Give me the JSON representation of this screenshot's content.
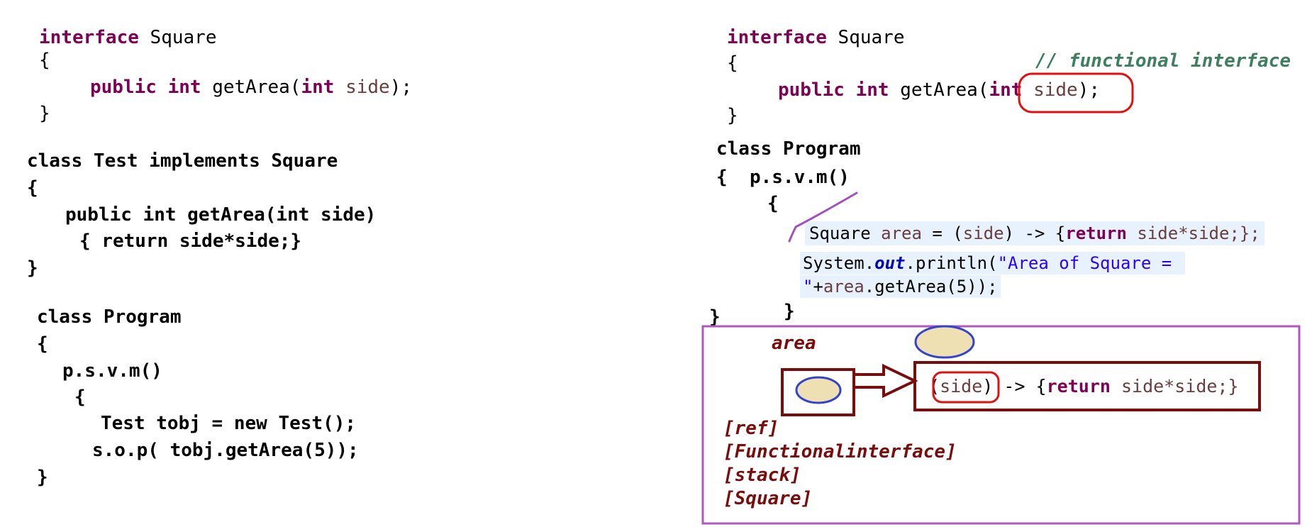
{
  "left": {
    "interface_kw": "interface",
    "interface_name": "Square",
    "open_brace": "{",
    "close_brace": "}",
    "method_public": "public",
    "method_int": "int",
    "method_name": "getArea(",
    "param_int": "int",
    "param_name": "side",
    "method_end": ");",
    "class_test_line": "class Test implements Square",
    "test_open": "{",
    "test_method": "public int getArea(int side)",
    "test_body": "{ return side*side;}",
    "test_close": "}",
    "program_line": "class Program",
    "program_open": "{",
    "psvm": "p.s.v.m()",
    "main_open": "{",
    "tobj_line": "Test tobj = new Test();",
    "sop_line": "s.o.p( tobj.getArea(5));",
    "main_close": "}"
  },
  "right": {
    "interface_kw": "interface",
    "interface_name": "Square",
    "open_brace": "{",
    "comment": "// functional interface",
    "method_public": "public",
    "method_int": "int",
    "method_name": "getArea(",
    "param_int": "int",
    "param_name": "side",
    "method_end": ");",
    "close_brace": "}",
    "program_line": "class Program",
    "program_open": "{",
    "psvm": "p.s.v.m()",
    "main_open": "{",
    "lambda_type": "Square",
    "lambda_var": "area",
    "lambda_eq": " = (",
    "lambda_param": "side",
    "lambda_arrow": ") -> {",
    "lambda_return": "return",
    "lambda_body": " side*side;};",
    "println_prefix": "System.",
    "println_out": "out",
    "println_call": ".println(",
    "println_str1": "\"Area of Square = ",
    "println_str2": "\"",
    "println_plus": "+",
    "println_var": "area",
    "println_rest": ".getArea(5));",
    "main_close": "}",
    "program_close": "}"
  },
  "memory": {
    "area_label": "area",
    "obj_paren_open": "(",
    "obj_param": "side",
    "obj_paren_close": ")",
    "obj_arrow": " -> {",
    "obj_return": "return",
    "obj_body": " side*side;}",
    "labels": [
      "[ref]",
      "[Functionalinterface]",
      "[stack]",
      "[Square]"
    ]
  },
  "colors": {
    "keyword": "#7f0055",
    "variable": "#6a3e3e",
    "string": "#2a00ff",
    "field": "#0000c0",
    "comment": "#3f7f5f",
    "dark_red": "#7b0c0c",
    "red_outline": "#e01010",
    "purple_frame": "#b057c0",
    "blue_ellipse": "#3344cc",
    "ellipse_fill": "#efe0b4",
    "highlight": "#e8f2fe"
  }
}
